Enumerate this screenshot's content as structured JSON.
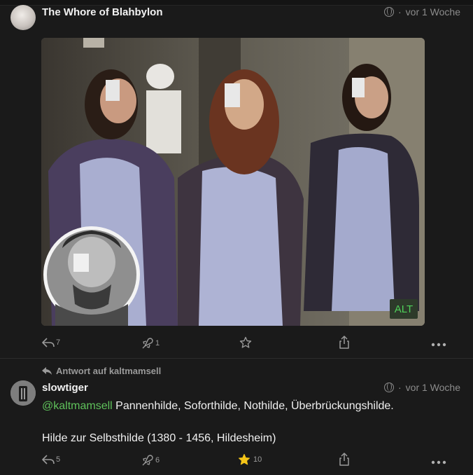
{
  "post1": {
    "author": "The Whore of Blahbylon",
    "time": "vor 1 Woche",
    "media": {
      "alt_badge": "ALT"
    },
    "actions": {
      "reply_count": "7",
      "boost_count": "1"
    }
  },
  "post2": {
    "reply_to": "Antwort auf kaltmamsell",
    "author": "slowtiger",
    "time": "vor 1 Woche",
    "mention": "@kaltmamsell",
    "line1_rest": " Pannenhilde, Soforthilde, Nothilde, Überbrückungshilde.",
    "line2": "Hilde zur Selbsthilde (1380 - 1456, Hildesheim)",
    "actions": {
      "reply_count": "5",
      "boost_count": "6",
      "favourite_count": "10"
    }
  },
  "colors": {
    "background": "#1a1a1a",
    "mention": "#5fc25b",
    "alt_green": "#4fd15a",
    "star_active": "#f5c518",
    "muted": "#9a9a9a"
  },
  "icons": [
    "globe-icon",
    "reply-icon",
    "boost-icon",
    "star-icon",
    "share-icon",
    "more-icon",
    "reply-arrow-icon"
  ]
}
